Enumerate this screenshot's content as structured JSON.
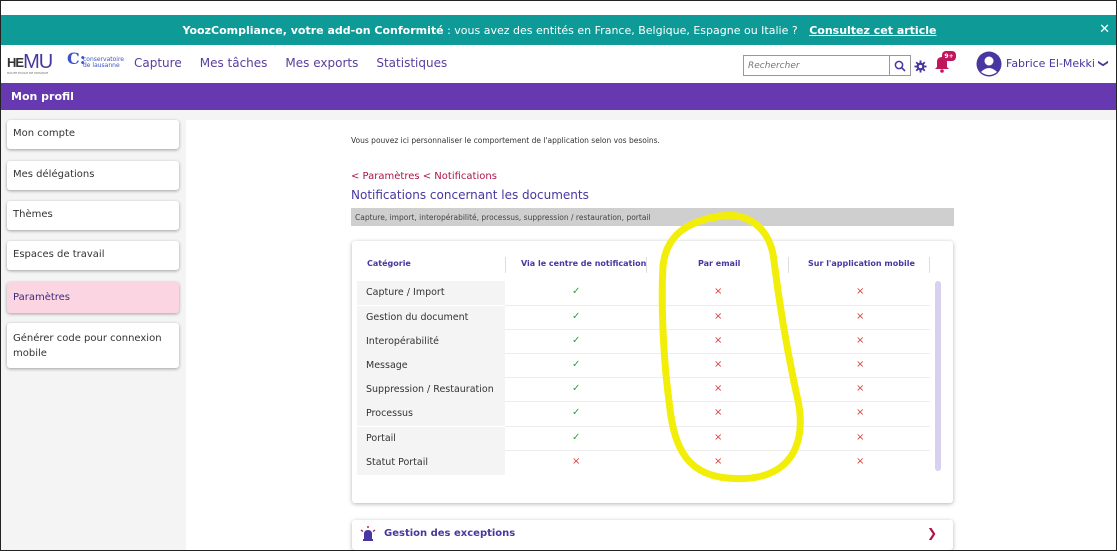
{
  "banner": {
    "brand": "YoozCompliance, votre add-on Conformité",
    "text": " : vous avez des entités en France, Belgique, Espagne ou Italie ? ",
    "link": "Consultez cet article",
    "close": "✕"
  },
  "header": {
    "logo_he": "HE",
    "logo_mu": "MU",
    "logo_sub": "HAUTE ÉCOLE DE MUSIQUE",
    "logo2_letter": "C:",
    "logo2_line1": "conservatoire",
    "logo2_line2": "de lausanne",
    "nav": [
      "Capture",
      "Mes tâches",
      "Mes exports",
      "Statistiques"
    ],
    "search_placeholder": "Rechercher",
    "notif_badge": "9+",
    "user_name": "Fabrice El-Mekki",
    "caret": "❯"
  },
  "page_title": "Mon profil",
  "sidebar": {
    "items": [
      {
        "label": "Mon compte"
      },
      {
        "label": "Mes délégations"
      },
      {
        "label": "Thèmes"
      },
      {
        "label": "Espaces de travail"
      },
      {
        "label": "Paramètres"
      },
      {
        "label": "Générer code pour connexion mobile"
      }
    ],
    "active_index": 4
  },
  "main": {
    "intro": "Vous pouvez ici personnaliser le comportement de l'application selon vos besoins.",
    "breadcrumb": "< Paramètres < Notifications",
    "heading": "Notifications concernant les documents",
    "subtitle": "Capture, import, interopérabilité, processus, suppression / restauration, portail",
    "table": {
      "headers": [
        "Catégorie",
        "Via le centre de notification",
        "Par email",
        "Sur l'application mobile"
      ],
      "rows": [
        {
          "category": "Capture / Import",
          "centre": "✓",
          "email": "×",
          "mobile": "×"
        },
        {
          "category": "Gestion du document",
          "centre": "✓",
          "email": "×",
          "mobile": "×"
        },
        {
          "category": "Interopérabilité",
          "centre": "✓",
          "email": "×",
          "mobile": "×"
        },
        {
          "category": "Message",
          "centre": "✓",
          "email": "×",
          "mobile": "×"
        },
        {
          "category": "Suppression / Restauration",
          "centre": "✓",
          "email": "×",
          "mobile": "×"
        },
        {
          "category": "Processus",
          "centre": "✓",
          "email": "×",
          "mobile": "×"
        },
        {
          "category": "Portail",
          "centre": "✓",
          "email": "×",
          "mobile": "×"
        },
        {
          "category": "Statut Portail",
          "centre": "×",
          "email": "×",
          "mobile": "×"
        }
      ]
    },
    "exceptions_label": "Gestion des exceptions",
    "exceptions_chevron": "❯"
  },
  "colors": {
    "banner": "#0e9b98",
    "purple": "#6739b0",
    "accent": "#b0134b",
    "check": "#2ea043",
    "cross": "#e03a3a",
    "highlight": "#f2ee0a"
  }
}
